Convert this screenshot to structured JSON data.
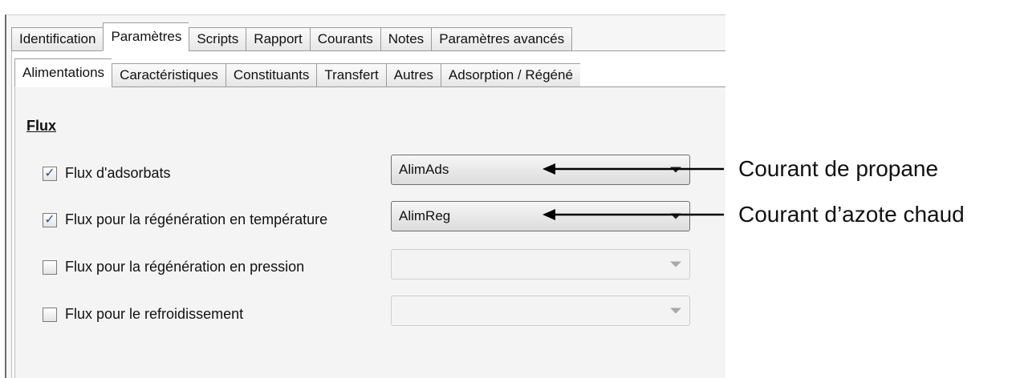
{
  "tabs_main": [
    {
      "label": "Identification"
    },
    {
      "label": "Paramètres"
    },
    {
      "label": "Scripts"
    },
    {
      "label": "Rapport"
    },
    {
      "label": "Courants"
    },
    {
      "label": "Notes"
    },
    {
      "label": "Paramètres avancés"
    }
  ],
  "tabs_sub": [
    {
      "label": "Alimentations"
    },
    {
      "label": "Caractéristiques"
    },
    {
      "label": "Constituants"
    },
    {
      "label": "Transfert"
    },
    {
      "label": "Autres"
    },
    {
      "label": "Adsorption / Régéné"
    }
  ],
  "section": {
    "title": "Flux"
  },
  "rows": [
    {
      "label": "Flux d'adsorbats",
      "checked": true,
      "value": "AlimAds"
    },
    {
      "label": "Flux pour la régénération en température",
      "checked": true,
      "value": "AlimReg"
    },
    {
      "label": "Flux pour la régénération en pression",
      "checked": false,
      "value": ""
    },
    {
      "label": "Flux pour le refroidissement",
      "checked": false,
      "value": ""
    }
  ],
  "annotations": [
    {
      "text": "Courant de propane"
    },
    {
      "text": "Courant d’azote chaud"
    }
  ],
  "icons": {
    "checkmark": "✓"
  }
}
